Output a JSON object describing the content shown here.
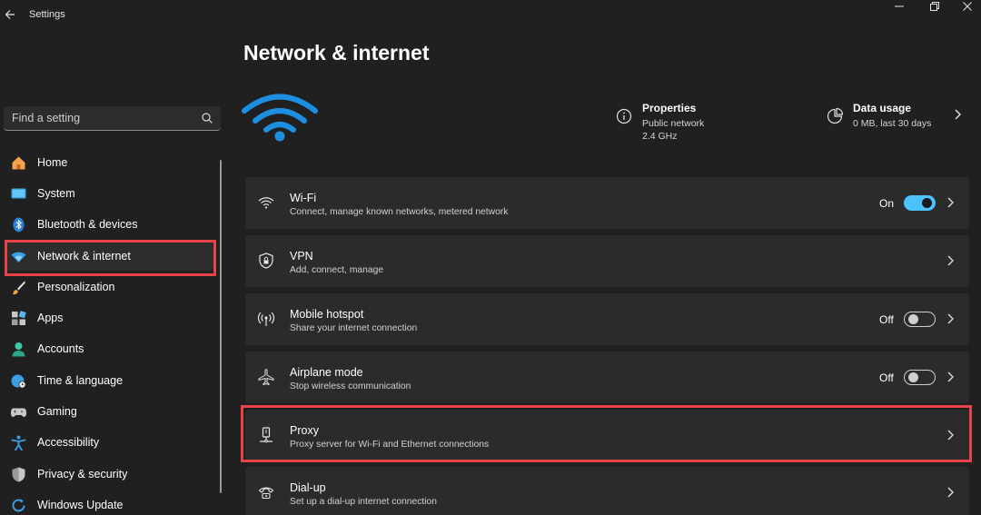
{
  "window": {
    "title": "Settings",
    "back_icon": "back-arrow-icon",
    "controls": {
      "minimize_icon": "minimize-icon",
      "maximize_icon": "restore-icon",
      "close_icon": "close-icon"
    }
  },
  "sidebar": {
    "search": {
      "placeholder": "Find a setting",
      "icon": "search-icon"
    },
    "items": [
      {
        "label": "Home",
        "icon": "home-icon"
      },
      {
        "label": "System",
        "icon": "system-display-icon"
      },
      {
        "label": "Bluetooth & devices",
        "icon": "bluetooth-icon"
      },
      {
        "label": "Network & internet",
        "icon": "wifi-icon",
        "selected": true
      },
      {
        "label": "Personalization",
        "icon": "brush-icon"
      },
      {
        "label": "Apps",
        "icon": "apps-icon"
      },
      {
        "label": "Accounts",
        "icon": "account-icon"
      },
      {
        "label": "Time & language",
        "icon": "globe-clock-icon"
      },
      {
        "label": "Gaming",
        "icon": "gamepad-icon"
      },
      {
        "label": "Accessibility",
        "icon": "accessibility-icon"
      },
      {
        "label": "Privacy & security",
        "icon": "shield-icon"
      },
      {
        "label": "Windows Update",
        "icon": "update-icon"
      }
    ]
  },
  "main": {
    "title": "Network & internet",
    "hero_icon": "wifi-icon",
    "properties": {
      "title": "Properties",
      "line1": "Public network",
      "line2": "2.4 GHz",
      "icon": "info-icon"
    },
    "data_usage": {
      "title": "Data usage",
      "line1": "0 MB, last 30 days",
      "icon": "data-usage-icon"
    },
    "cards": [
      {
        "title": "Wi-Fi",
        "subtitle": "Connect, manage known networks, metered network",
        "icon": "wifi-icon",
        "toggle": true,
        "state": "On",
        "on": true
      },
      {
        "title": "VPN",
        "subtitle": "Add, connect, manage",
        "icon": "vpn-shield-icon",
        "toggle": false
      },
      {
        "title": "Mobile hotspot",
        "subtitle": "Share your internet connection",
        "icon": "hotspot-icon",
        "toggle": true,
        "state": "Off",
        "on": false
      },
      {
        "title": "Airplane mode",
        "subtitle": "Stop wireless communication",
        "icon": "airplane-icon",
        "toggle": true,
        "state": "Off",
        "on": false
      },
      {
        "title": "Proxy",
        "subtitle": "Proxy server for Wi-Fi and Ethernet connections",
        "icon": "proxy-icon",
        "toggle": false
      },
      {
        "title": "Dial-up",
        "subtitle": "Set up a dial-up internet connection",
        "icon": "dialup-icon",
        "toggle": false
      }
    ]
  },
  "colors": {
    "accent": "#4cc2ff",
    "highlight": "#e8434b",
    "card": "#2b2b2b",
    "background": "#202020"
  }
}
